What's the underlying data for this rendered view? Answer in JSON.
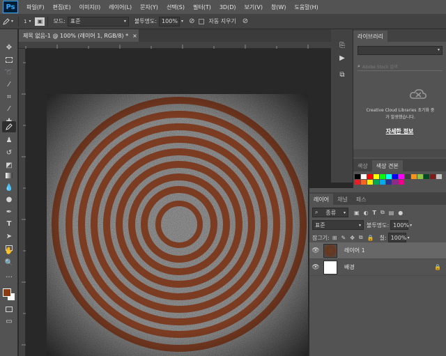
{
  "app": {
    "logo": "Ps"
  },
  "menu": [
    "파일(F)",
    "편집(E)",
    "이미지(I)",
    "레이어(L)",
    "문자(Y)",
    "선택(S)",
    "필터(T)",
    "3D(D)",
    "보기(V)",
    "창(W)",
    "도움말(H)"
  ],
  "options": {
    "brush_size": "1",
    "mode_label": "모드:",
    "mode_value": "표준",
    "opacity_label": "불투명도:",
    "opacity_value": "100%",
    "auto_erase_label": "자동 지우기"
  },
  "document": {
    "tab_title": "제목 없음-1 @ 100% (레이어 1, RGB/8) *"
  },
  "colors": {
    "foreground": "#8b3a12",
    "background": "#ffffff",
    "ring": "#7a3417"
  },
  "libraries": {
    "tab": "라이브러리",
    "search_placeholder": "Adobe Stock 검색",
    "message_line1": "Creative Cloud Libraries 초기화 중",
    "message_line2": "가 발생했습니다.",
    "more_info": "자세한 정보"
  },
  "swatches_tabs": [
    "색상",
    "색상 견본"
  ],
  "swatches": [
    "#000000",
    "#ffffff",
    "#ff0000",
    "#ffff00",
    "#00ff00",
    "#00ffff",
    "#0000ff",
    "#ff00ff",
    "#3b3b3b",
    "#f7941d",
    "#8dc63f",
    "#004b23",
    "#7f1b1b",
    "#c0c0c0",
    "#ed1c24",
    "#f26522",
    "#fff200",
    "#00a651",
    "#00aeef",
    "#2e3192",
    "#92278f",
    "#ec008c"
  ],
  "layers_panel": {
    "tabs": [
      "레이어",
      "채널",
      "패스"
    ],
    "filter_label": "종류",
    "blend_mode": "표준",
    "opacity_label": "불투명도:",
    "opacity_value": "100%",
    "lock_label": "잠그기:",
    "fill_label": "칠:",
    "fill_value": "100%",
    "layers": [
      {
        "name": "레이어 1",
        "selected": true
      },
      {
        "name": "배경",
        "selected": false
      }
    ]
  }
}
